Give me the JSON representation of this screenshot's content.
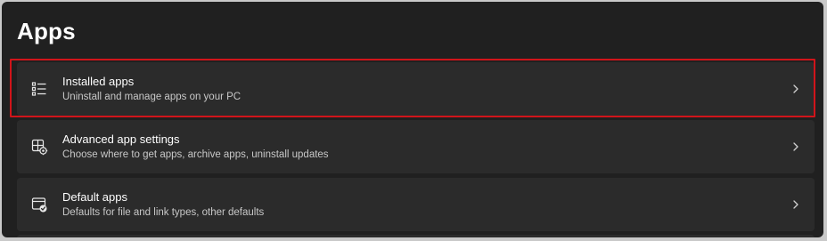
{
  "page": {
    "title": "Apps"
  },
  "items": [
    {
      "title": "Installed apps",
      "description": "Uninstall and manage apps on your PC",
      "icon": "installed-apps-list-icon"
    },
    {
      "title": "Advanced app settings",
      "description": "Choose where to get apps, archive apps, uninstall updates",
      "icon": "advanced-app-settings-icon"
    },
    {
      "title": "Default apps",
      "description": "Defaults for file and link types, other defaults",
      "icon": "default-apps-icon"
    }
  ],
  "colors": {
    "window_background": "#202020",
    "card_background": "#2b2b2b",
    "highlight": "#d1141a",
    "text_primary": "#ffffff",
    "text_secondary": "#c8c8c8"
  }
}
